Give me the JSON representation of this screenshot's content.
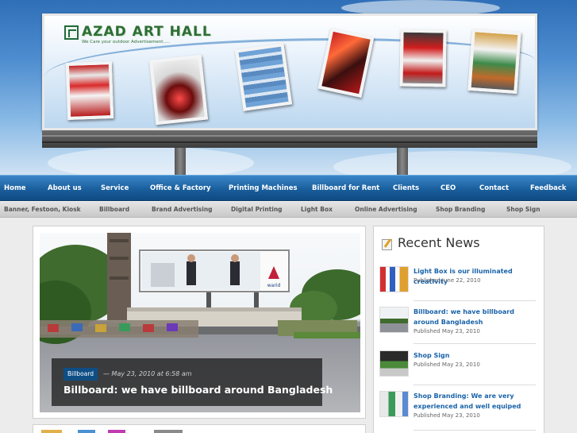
{
  "brand": {
    "name": "AZAD ART HALL",
    "tagline": "We Care your outdoor Advertisement....."
  },
  "main_nav": [
    {
      "label": "Home"
    },
    {
      "label": "About us"
    },
    {
      "label": "Service"
    },
    {
      "label": "Office & Factory"
    },
    {
      "label": "Printing Machines"
    },
    {
      "label": "Billboard for Rent"
    },
    {
      "label": "Clients"
    },
    {
      "label": "CEO"
    },
    {
      "label": "Contact"
    },
    {
      "label": "Feedback"
    }
  ],
  "sub_nav": [
    {
      "label": "Banner, Festoon, Kiosk"
    },
    {
      "label": "Billboard"
    },
    {
      "label": "Brand Advertising"
    },
    {
      "label": "Digital Printing"
    },
    {
      "label": "Light Box"
    },
    {
      "label": "Online Advertising"
    },
    {
      "label": "Shop Branding"
    },
    {
      "label": "Shop Sign"
    }
  ],
  "featured": {
    "category": "Billboard",
    "meta": "— May 23, 2010 at 6:58 am",
    "title": "Billboard: we have billboard around Bangladesh",
    "billboard_brand": "warid"
  },
  "recent_news": {
    "heading": "Recent News",
    "items": [
      {
        "title": "Light Box is our illuminated creativity",
        "date": "Published June 22, 2010"
      },
      {
        "title": "Billboard: we have billboard around Bangladesh",
        "date": "Published May 23, 2010"
      },
      {
        "title": "Shop Sign",
        "date": "Published May 23, 2010"
      },
      {
        "title": "Shop Branding: We are very experienced and well equiped",
        "date": "Published May 23, 2010"
      }
    ]
  },
  "colors": {
    "nav_blue": "#1a5f9d",
    "link_blue": "#1a63a8",
    "logo_green": "#2e6e34",
    "category_badge": "#0e4e85"
  }
}
